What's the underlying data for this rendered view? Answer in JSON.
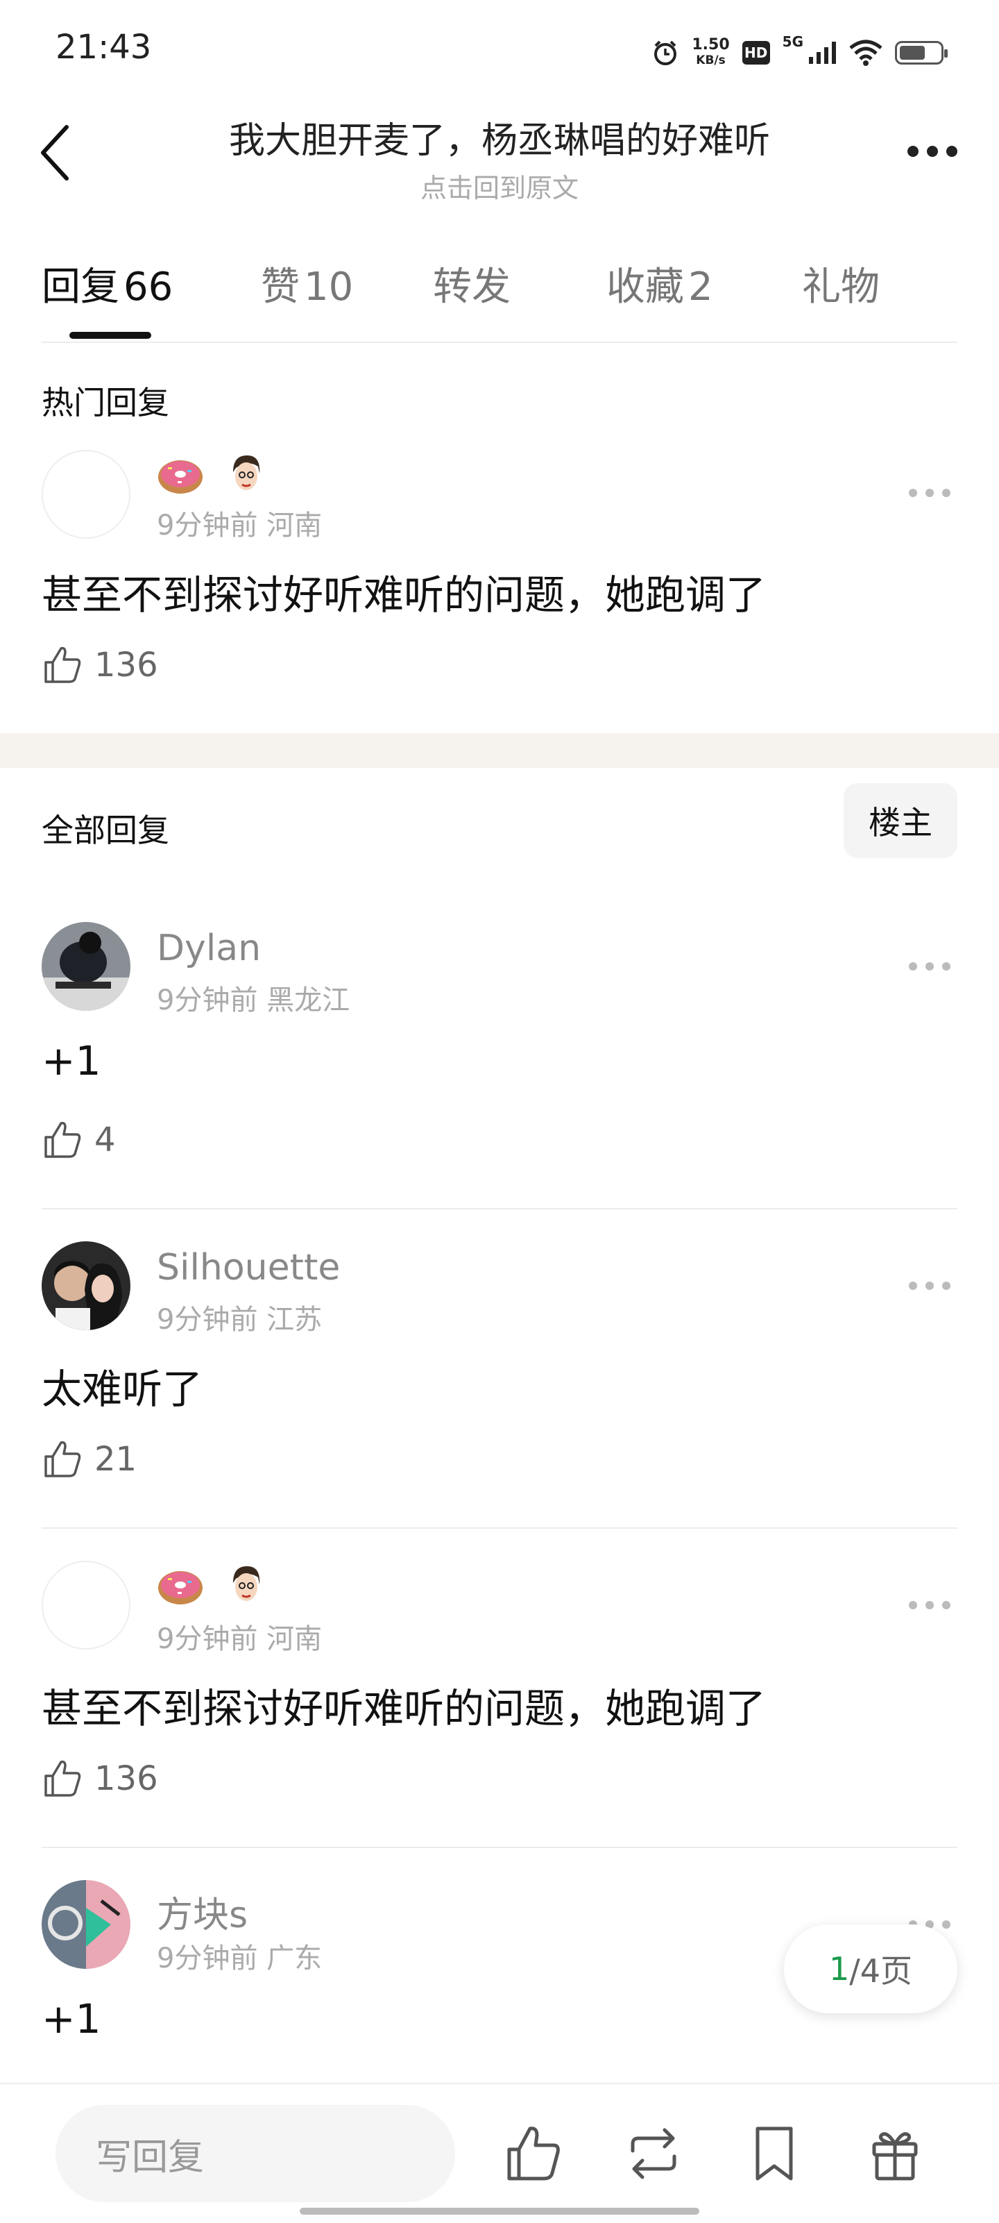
{
  "status_bar": {
    "time": "21:43",
    "net_speed_value": "1.50",
    "net_speed_unit": "KB/s",
    "hd": "HD",
    "signal": "5G"
  },
  "header": {
    "title": "我大胆开麦了，杨丞琳唱的好难听",
    "subtitle": "点击回到原文"
  },
  "tabs": [
    {
      "label": "回复",
      "count": "66"
    },
    {
      "label": "赞",
      "count": "10"
    },
    {
      "label": "转发",
      "count": ""
    },
    {
      "label": "收藏",
      "count": "2"
    },
    {
      "label": "礼物",
      "count": ""
    }
  ],
  "hot": {
    "title": "热门回复",
    "comment": {
      "icons": [
        "donut-icon",
        "face-icon"
      ],
      "time": "9分钟前",
      "location": "河南",
      "text": "甚至不到探讨好听难听的问题，她跑调了",
      "likes": "136"
    }
  },
  "all": {
    "title": "全部回复",
    "owner_filter": "楼主",
    "comments": [
      {
        "name": "Dylan",
        "time": "9分钟前",
        "location": "黑龙江",
        "text": "+1",
        "likes": "4"
      },
      {
        "name": "Silhouette",
        "time": "9分钟前",
        "location": "江苏",
        "text": "太难听了",
        "likes": "21"
      },
      {
        "name": "",
        "time": "9分钟前",
        "location": "河南",
        "text": "甚至不到探讨好听难听的问题，她跑调了",
        "likes": "136"
      },
      {
        "name": "方块s",
        "time": "9分钟前",
        "location": "广东",
        "text": "+1",
        "likes": ""
      }
    ]
  },
  "pagination": {
    "current": "1",
    "rest": "/4页"
  },
  "bottom": {
    "reply_placeholder": "写回复"
  }
}
